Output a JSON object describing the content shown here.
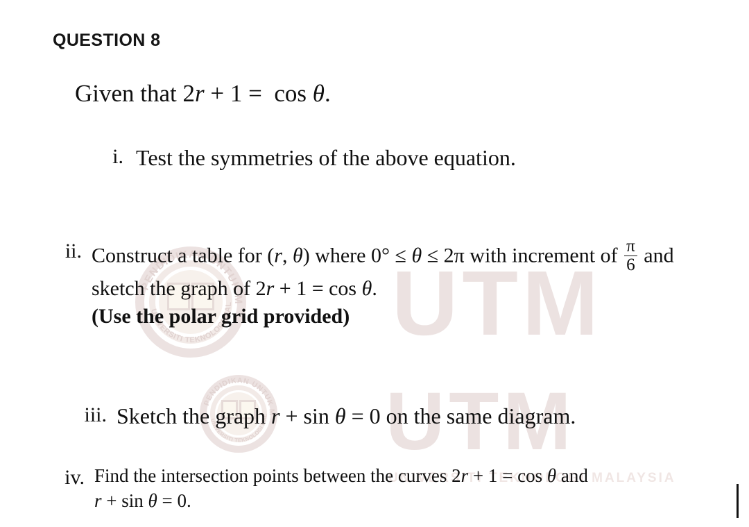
{
  "page": {
    "heading": "QUESTION 8",
    "given_line": "Given that 2r + 1 =  cos θ.",
    "background_color": "#ffffff",
    "text_color": "#101010"
  },
  "given": {
    "prefix": "Given that",
    "lhs": "2",
    "var_r": "r",
    "plus_one": "+ 1 =",
    "cos": "cos",
    "theta": "θ",
    "period": "."
  },
  "items": [
    {
      "marker": "i.",
      "text": "Test the symmetries of the above equation."
    },
    {
      "marker": "ii.",
      "line1_part1": "Construct a table for (",
      "line1_r": "r",
      "line1_comma": ", ",
      "line1_theta": "θ",
      "line1_part2": ") where 0° ≤ ",
      "line1_theta2": "θ",
      "line1_part3": " ≤ 2π with increment of",
      "frac_numerator": "π",
      "frac_denominator": "6",
      "line1_part4": "and",
      "line2_part1": "sketch the graph of 2",
      "line2_r": "r",
      "line2_part2": "+ 1 =  cos ",
      "line2_theta": "θ",
      "line2_part3": ".",
      "line3_note": "(Use the polar grid provided)"
    },
    {
      "marker": "iii.",
      "part1": "Sketch the graph ",
      "var_r": "r",
      "part2": " + sin ",
      "theta": "θ",
      "part3": " = 0 on the same diagram."
    },
    {
      "marker": "iv.",
      "line1_part1": "Find the intersection points between the curves 2",
      "line1_r": "r",
      "line1_part2": " + 1 =  cos ",
      "line1_theta": "θ",
      "line1_part3": " and",
      "line2_r": "r",
      "line2_part1": " + sin ",
      "line2_theta": "θ",
      "line2_part2": " = 0."
    }
  ],
  "watermark": {
    "letters": "UTM",
    "ring_text_upper": "PENDIDIKAN UNTUK MASA",
    "ring_text_lower": "UNIVERSITI TEKNOLOGI MALAYSIA",
    "subtitle": "UNIVERSITI TEKNOLOGI MALAYSIA",
    "color": "#ece2e1",
    "core_color": "#f7f1ec"
  }
}
